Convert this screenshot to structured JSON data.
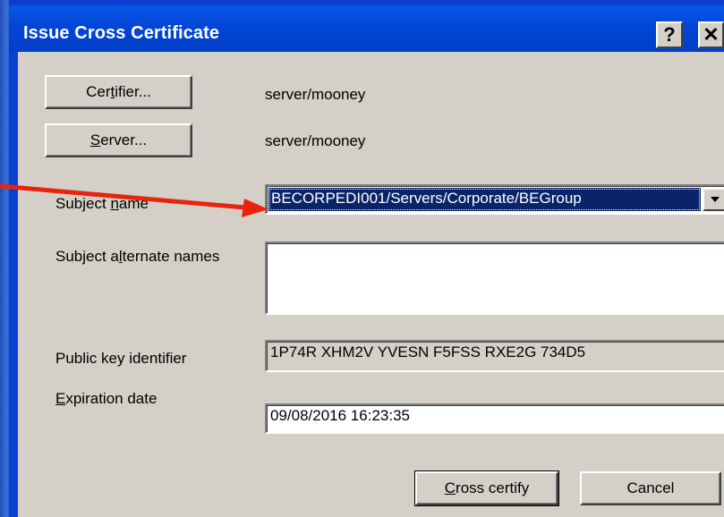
{
  "window": {
    "title": "Issue Cross Certificate",
    "help_glyph": "?",
    "close_glyph": "✕"
  },
  "certifier": {
    "button_pre": "Cer",
    "button_underline": "t",
    "button_post": "ifier...",
    "value": "server/mooney"
  },
  "server": {
    "button_underline": "S",
    "button_post": "erver...",
    "value": "server/mooney"
  },
  "subject_name": {
    "label_pre": "Subject ",
    "label_underline": "n",
    "label_post": "ame",
    "selected_value": "BECORPEDI001/Servers/Corporate/BEGroup"
  },
  "subject_alternate_names": {
    "label_pre": "Subject a",
    "label_underline": "l",
    "label_post": "ternate names",
    "value": ""
  },
  "public_key": {
    "label": "Public key identifier",
    "value": "1P74R XHM2V YVESN F5FSS RXE2G 734D5"
  },
  "expiration": {
    "label_underline": "E",
    "label_post": "xpiration date",
    "value": "09/08/2016 16:23:35"
  },
  "buttons": {
    "cross_certify_underline": "C",
    "cross_certify_post": "ross certify",
    "cancel": "Cancel"
  },
  "colors": {
    "annotation_arrow": "#e8230e",
    "titlebar": "#0246d8",
    "dialog_face": "#d4d0c8",
    "selection": "#0a246a"
  }
}
